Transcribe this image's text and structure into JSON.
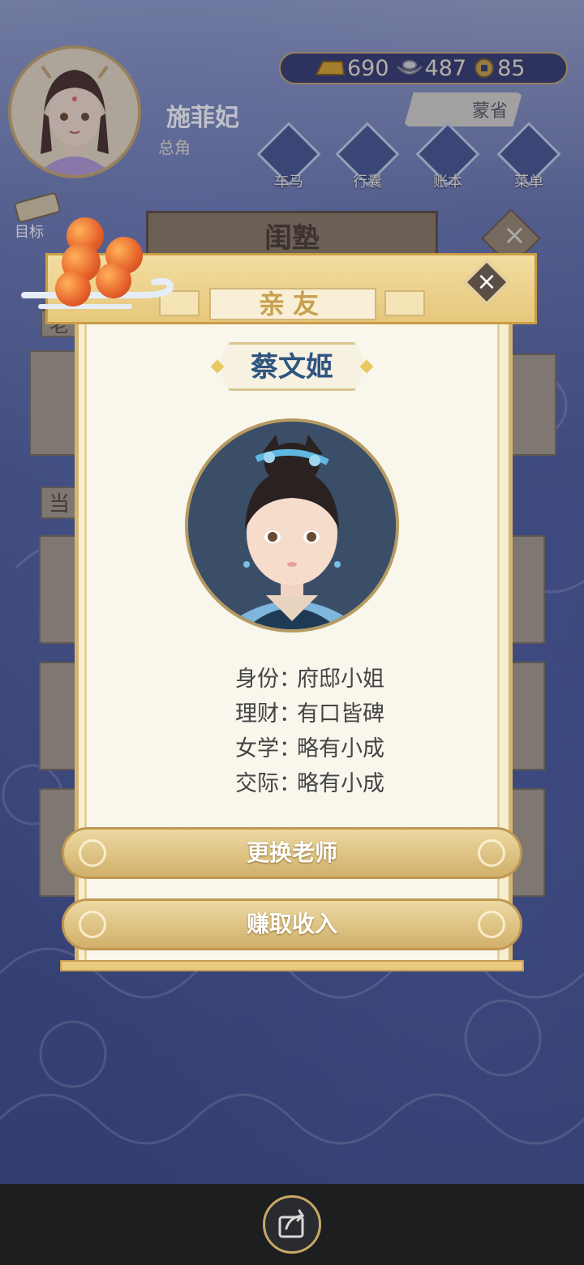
{
  "header": {
    "player_name": "施菲妃",
    "player_title": "总角",
    "currency": {
      "gold": "690",
      "silver": "487",
      "coin": "85"
    },
    "meng_button": "蒙省",
    "nav": [
      {
        "label": "车马",
        "icon": "carriage-icon"
      },
      {
        "label": "行囊",
        "icon": "bag-icon"
      },
      {
        "label": "账本",
        "icon": "ledger-icon"
      },
      {
        "label": "菜单",
        "icon": "menu-icon"
      }
    ],
    "goal_label": "目标"
  },
  "background_panel": {
    "title": "闺塾",
    "side_chars": [
      "老",
      "当"
    ]
  },
  "modal": {
    "title": "亲友",
    "person_name": "蔡文姬",
    "info": [
      {
        "label": "身份",
        "value": "府邸小姐"
      },
      {
        "label": "理财",
        "value": "有口皆碑"
      },
      {
        "label": "女学",
        "value": "略有小成"
      },
      {
        "label": "交际",
        "value": "略有小成"
      }
    ],
    "sep": "：",
    "buttons": {
      "change_teacher": "更换老师",
      "earn_income": "赚取收入"
    },
    "close_symbol": "×"
  },
  "colors": {
    "accent_gold": "#d6b570",
    "name_blue": "#2f5580",
    "background_blue": "#3f4c88"
  }
}
